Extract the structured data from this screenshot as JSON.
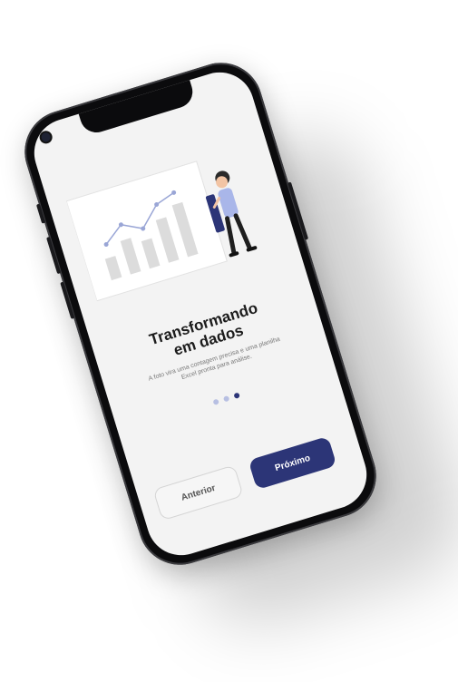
{
  "onboarding": {
    "title_line1": "Transformando",
    "title_line2": "em dados",
    "subtitle_line1": "A foto vira uma contagem precisa e uma planilha",
    "subtitle_line2": "Excel pronta para análise.",
    "pagination": {
      "total": 3,
      "active_index": 2
    },
    "prev_label": "Anterior",
    "next_label": "Próximo"
  },
  "illustration": {
    "icon": "data-analyst-presenting-chart-illustration",
    "bar_values": [
      0.35,
      0.55,
      0.45,
      0.7,
      0.85
    ],
    "line_values": [
      0.45,
      0.68,
      0.52,
      0.82,
      0.92
    ]
  },
  "colors": {
    "primary": "#2c3577",
    "dot_inactive": "#b7bfe2",
    "screen_bg": "#f3f3f3",
    "bezel": "#0b0b0d"
  }
}
